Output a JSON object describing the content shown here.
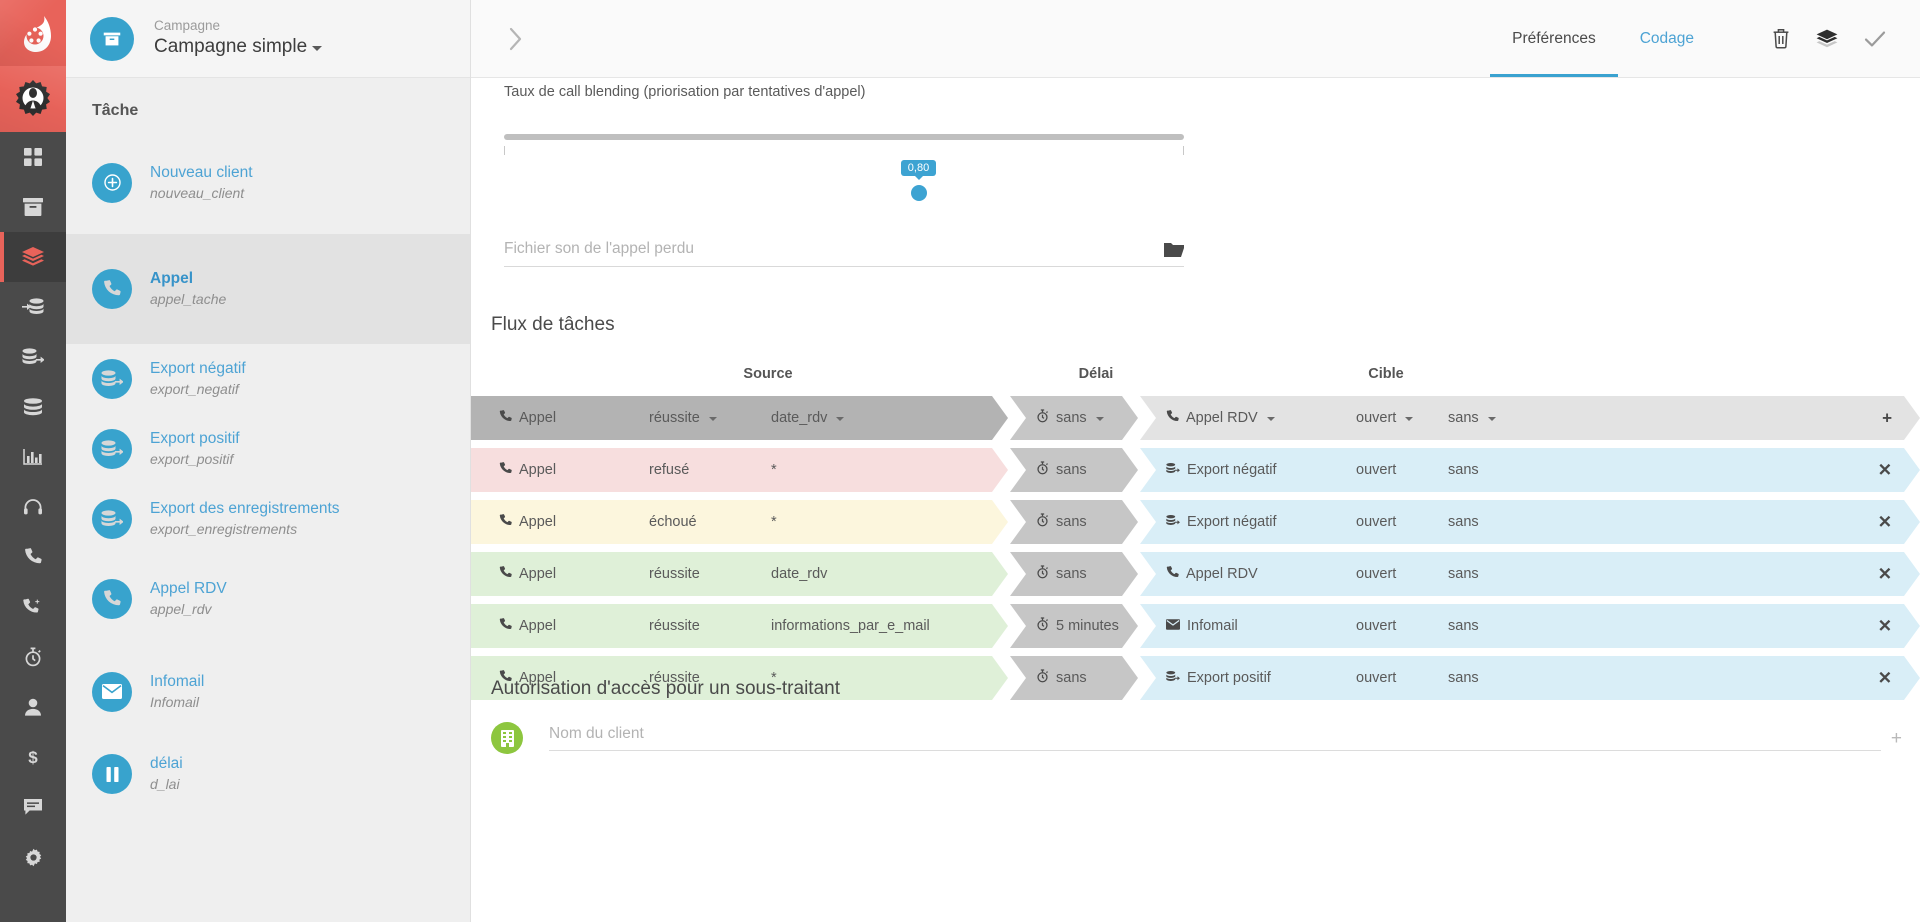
{
  "rail": {
    "logo_top": "flame-logo-icon",
    "logo_bottom": "gear-agent-logo-icon",
    "items": [
      {
        "icon": "grid-dashboard-icon",
        "active": false
      },
      {
        "icon": "archive-box-icon",
        "active": false
      },
      {
        "icon": "layers-stack-icon",
        "active": true
      },
      {
        "icon": "database-import-icon",
        "active": false
      },
      {
        "icon": "database-export-icon",
        "active": false
      },
      {
        "icon": "database-icon",
        "active": false
      },
      {
        "icon": "bar-chart-icon",
        "active": false
      },
      {
        "icon": "headset-icon",
        "active": false
      },
      {
        "icon": "phone-icon",
        "active": false
      },
      {
        "icon": "phone-keypad-icon",
        "active": false
      },
      {
        "icon": "stopwatch-icon",
        "active": false
      },
      {
        "icon": "user-icon",
        "active": false
      },
      {
        "icon": "dollar-icon",
        "active": false
      },
      {
        "icon": "chat-bubble-icon",
        "active": false
      },
      {
        "icon": "gear-settings-icon",
        "active": false
      }
    ]
  },
  "sidebar": {
    "campaign_label": "Campagne",
    "campaign_name": "Campagne simple",
    "campaign_icon": "archive-box-icon",
    "section_title": "Tâche",
    "tasks": [
      {
        "title": "Nouveau client",
        "sub": "nouveau_client",
        "icon": "plus-circle-icon",
        "selected": false
      },
      {
        "title": "Appel",
        "sub": "appel_tache",
        "icon": "phone-icon",
        "selected": true
      },
      {
        "title": "Export négatif",
        "sub": "export_negatif",
        "icon": "database-export-icon",
        "selected": false
      },
      {
        "title": "Export positif",
        "sub": "export_positif",
        "icon": "database-export-icon",
        "selected": false
      },
      {
        "title": "Export des enregistrements",
        "sub": "export_enregistrements",
        "icon": "database-export-icon",
        "selected": false
      },
      {
        "title": "Appel RDV",
        "sub": "appel_rdv",
        "icon": "phone-icon",
        "selected": false
      },
      {
        "title": "Infomail",
        "sub": "Infomail",
        "icon": "envelope-icon",
        "selected": false
      },
      {
        "title": "délai",
        "sub": "d_lai",
        "icon": "pause-icon",
        "selected": false
      }
    ]
  },
  "topbar": {
    "collapse_icon": "chevron-right-icon",
    "tabs": [
      {
        "label": "Préférences",
        "active": true
      },
      {
        "label": "Codage",
        "active": false
      }
    ],
    "actions": [
      {
        "icon": "trash-delete-icon"
      },
      {
        "icon": "layers-duplicate-icon"
      },
      {
        "icon": "check-save-icon"
      }
    ]
  },
  "main": {
    "slider": {
      "label": "Taux de call blending (priorisation par tentatives d'appel)",
      "value": "0,80",
      "percent": 61
    },
    "file_field": {
      "placeholder": "Fichier son de l'appel perdu",
      "value": "",
      "browse_icon": "folder-open-icon"
    },
    "flow": {
      "title": "Flux de tâches",
      "columns": [
        "Source",
        "Délai",
        "Cible"
      ],
      "rows": [
        {
          "is_new": true,
          "src_color": "#b3b3b3",
          "delay_color": "#c6c6c6",
          "target_color": "#e3e3e3",
          "source_task": "Appel",
          "source_icon": "phone-icon",
          "source_status": "réussite",
          "source_code": "date_rdv",
          "delay_icon": "stopwatch-icon",
          "delay": "sans",
          "target_task": "Appel RDV",
          "target_icon": "phone-icon",
          "target_state": "ouvert",
          "target_extra": "sans",
          "dropdown": true,
          "action": "+",
          "action_name": "add-flow-button"
        },
        {
          "is_new": false,
          "src_color": "#f7dede",
          "delay_color": "#c6c6c6",
          "target_color": "#d9eef7",
          "source_task": "Appel",
          "source_icon": "phone-icon",
          "source_status": "refusé",
          "source_code": "*",
          "delay_icon": "stopwatch-icon",
          "delay": "sans",
          "target_task": "Export négatif",
          "target_icon": "database-export-icon",
          "target_state": "ouvert",
          "target_extra": "sans",
          "dropdown": false,
          "action": "✕",
          "action_name": "remove-flow-button"
        },
        {
          "is_new": false,
          "src_color": "#fcf6dd",
          "delay_color": "#c6c6c6",
          "target_color": "#d9eef7",
          "source_task": "Appel",
          "source_icon": "phone-icon",
          "source_status": "échoué",
          "source_code": "*",
          "delay_icon": "stopwatch-icon",
          "delay": "sans",
          "target_task": "Export négatif",
          "target_icon": "database-export-icon",
          "target_state": "ouvert",
          "target_extra": "sans",
          "dropdown": false,
          "action": "✕",
          "action_name": "remove-flow-button"
        },
        {
          "is_new": false,
          "src_color": "#dff0d8",
          "delay_color": "#c6c6c6",
          "target_color": "#d9eef7",
          "source_task": "Appel",
          "source_icon": "phone-icon",
          "source_status": "réussite",
          "source_code": "date_rdv",
          "delay_icon": "stopwatch-icon",
          "delay": "sans",
          "target_task": "Appel RDV",
          "target_icon": "phone-icon",
          "target_state": "ouvert",
          "target_extra": "sans",
          "dropdown": false,
          "action": "✕",
          "action_name": "remove-flow-button"
        },
        {
          "is_new": false,
          "src_color": "#dff0d8",
          "delay_color": "#c6c6c6",
          "target_color": "#d9eef7",
          "source_task": "Appel",
          "source_icon": "phone-icon",
          "source_status": "réussite",
          "source_code": "informations_par_e_mail",
          "delay_icon": "stopwatch-icon",
          "delay": "5 minutes",
          "target_task": "Infomail",
          "target_icon": "envelope-icon",
          "target_state": "ouvert",
          "target_extra": "sans",
          "dropdown": false,
          "action": "✕",
          "action_name": "remove-flow-button"
        },
        {
          "is_new": false,
          "src_color": "#dff0d8",
          "delay_color": "#c6c6c6",
          "target_color": "#d9eef7",
          "source_task": "Appel",
          "source_icon": "phone-icon",
          "source_status": "réussite",
          "source_code": "*",
          "delay_icon": "stopwatch-icon",
          "delay": "sans",
          "target_task": "Export positif",
          "target_icon": "database-export-icon",
          "target_state": "ouvert",
          "target_extra": "sans",
          "dropdown": false,
          "action": "✕",
          "action_name": "remove-flow-button"
        }
      ]
    },
    "subcontractor": {
      "title": "Autorisation d'accès pour un sous-traitant",
      "avatar_icon": "building-icon",
      "placeholder": "Nom du client",
      "value": "",
      "add_icon": "plus-icon",
      "add_label": "+"
    }
  },
  "colors": {
    "brand_red": "#e8635a",
    "accent_blue": "#3da3d2",
    "rail_dark": "#4a4a4a",
    "green": "#8dc63f"
  }
}
